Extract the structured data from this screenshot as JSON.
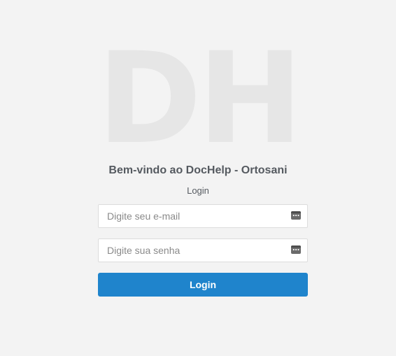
{
  "logo": {
    "text": "DH",
    "color": "#e6e6e6"
  },
  "header": {
    "welcome": "Bem-vindo ao DocHelp - Ortosani",
    "subtitle": "Login"
  },
  "form": {
    "email": {
      "placeholder": "Digite seu e-mail",
      "value": "",
      "icon": "password-manager-icon"
    },
    "password": {
      "placeholder": "Digite sua senha",
      "value": "",
      "icon": "password-manager-icon"
    },
    "submit_label": "Login"
  },
  "colors": {
    "background": "#f3f3f3",
    "accent": "#1f84cc",
    "text": "#555a60"
  }
}
